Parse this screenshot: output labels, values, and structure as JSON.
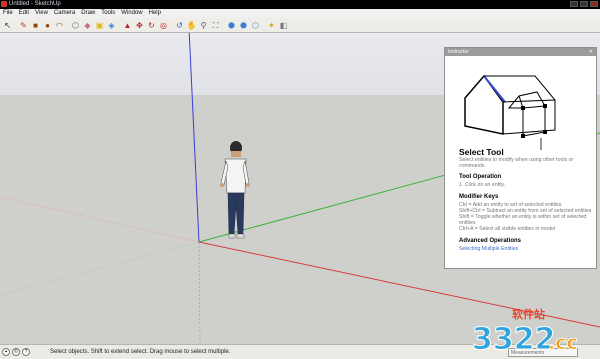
{
  "window": {
    "title": "Untitled - SketchUp"
  },
  "menu": [
    "File",
    "Edit",
    "View",
    "Camera",
    "Draw",
    "Tools",
    "Window",
    "Help"
  ],
  "toolbar": [
    {
      "icon": "select-arrow-icon",
      "glyph": "↖",
      "color": "#222"
    },
    {
      "icon": "sep"
    },
    {
      "icon": "line-pencil-icon",
      "glyph": "✎",
      "color": "#c0392b"
    },
    {
      "icon": "rectangle-icon",
      "glyph": "■",
      "color": "#8b4513"
    },
    {
      "icon": "circle-icon",
      "glyph": "●",
      "color": "#8b4513"
    },
    {
      "icon": "arc-icon",
      "glyph": "◠",
      "color": "#8b4513"
    },
    {
      "icon": "sep"
    },
    {
      "icon": "make-component-icon",
      "glyph": "⬡",
      "color": "#555"
    },
    {
      "icon": "eraser-icon",
      "glyph": "◆",
      "color": "#d46a8a"
    },
    {
      "icon": "tape-measure-icon",
      "glyph": "▣",
      "color": "#d9b21f"
    },
    {
      "icon": "paint-bucket-icon",
      "glyph": "◈",
      "color": "#3a7bd5"
    },
    {
      "icon": "sep"
    },
    {
      "icon": "push-pull-icon",
      "glyph": "▲",
      "color": "#b22222"
    },
    {
      "icon": "move-icon",
      "glyph": "✥",
      "color": "#b22222"
    },
    {
      "icon": "rotate-icon",
      "glyph": "↻",
      "color": "#b22222"
    },
    {
      "icon": "offset-icon",
      "glyph": "◎",
      "color": "#b22222"
    },
    {
      "icon": "sep"
    },
    {
      "icon": "orbit-icon",
      "glyph": "↺",
      "color": "#1f5fbf"
    },
    {
      "icon": "pan-icon",
      "glyph": "✋",
      "color": "#555"
    },
    {
      "icon": "zoom-icon",
      "glyph": "⚲",
      "color": "#555"
    },
    {
      "icon": "zoom-extents-icon",
      "glyph": "⛶",
      "color": "#555"
    },
    {
      "icon": "sep"
    },
    {
      "icon": "get-models-icon",
      "glyph": "⬢",
      "color": "#3a7bd5"
    },
    {
      "icon": "share-model-icon",
      "glyph": "⬣",
      "color": "#3a7bd5"
    },
    {
      "icon": "share-component-icon",
      "glyph": "⬡",
      "color": "#3a7bd5"
    },
    {
      "icon": "sep"
    },
    {
      "icon": "extension-warehouse-icon",
      "glyph": "✦",
      "color": "#d9a400"
    },
    {
      "icon": "layout-icon",
      "glyph": "◧",
      "color": "#777"
    }
  ],
  "instructor": {
    "panel_title": "Instructor",
    "tool_name": "Select Tool",
    "description": "Select entities to modify when using other tools or commands.",
    "tool_operation_heading": "Tool Operation",
    "tool_operation_steps": [
      "1.  Click on an entity."
    ],
    "modifier_keys_heading": "Modifier Keys",
    "modifier_keys": [
      "Ctrl = Add an entity to set of selected entities",
      "Shift+Ctrl = Subtract an entity from set of selected entities",
      "Shift = Toggle whether an entity is within set of selected entities",
      "Ctrl+A = Select all visible entities in model"
    ],
    "advanced_heading": "Advanced Operations",
    "advanced_link": "Selecting Multiple Entities"
  },
  "status": {
    "message": "Select objects. Shift to extend select. Drag mouse to select multiple.",
    "measurements_label": "Measurements"
  },
  "watermark": {
    "number": "3322",
    "suffix": ".cc",
    "cn": "软件站"
  }
}
